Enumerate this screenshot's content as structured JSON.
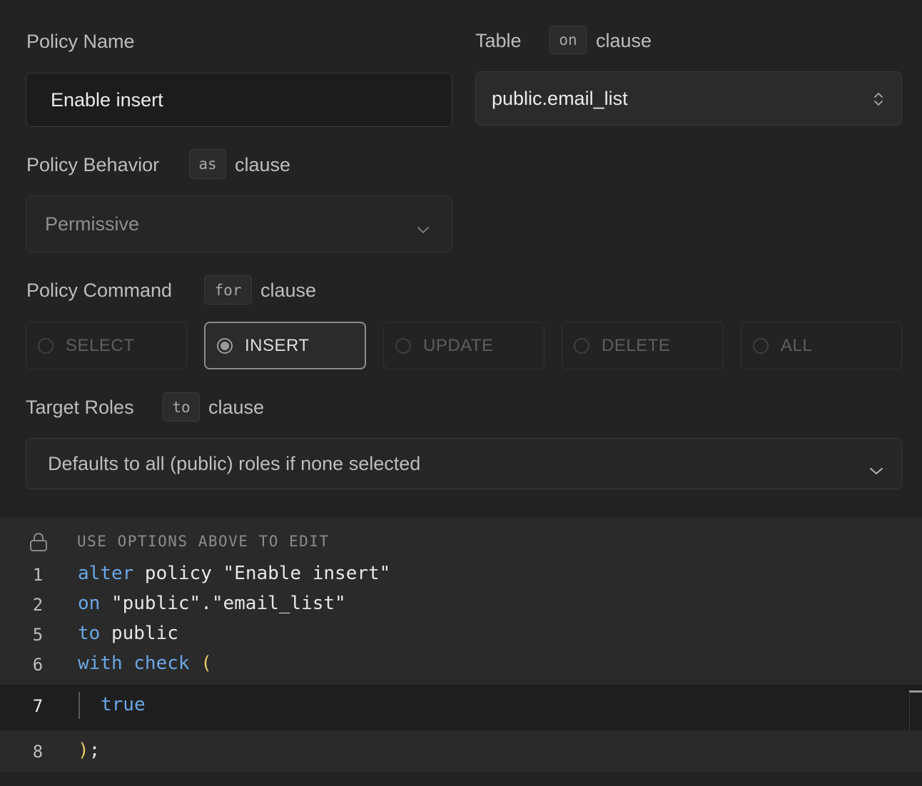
{
  "policy_name": {
    "label": "Policy Name",
    "value": "Enable insert"
  },
  "table": {
    "label": "Table",
    "clause_keyword": "on",
    "clause_label": "clause",
    "value": "public.email_list"
  },
  "behavior": {
    "label": "Policy Behavior",
    "clause_keyword": "as",
    "clause_label": "clause",
    "value": "Permissive"
  },
  "command": {
    "label": "Policy Command",
    "clause_keyword": "for",
    "clause_label": "clause",
    "options": [
      "SELECT",
      "INSERT",
      "UPDATE",
      "DELETE",
      "ALL"
    ],
    "selected": "INSERT"
  },
  "roles": {
    "label": "Target Roles",
    "clause_keyword": "to",
    "clause_label": "clause",
    "placeholder": "Defaults to all (public) roles if none selected"
  },
  "editor": {
    "header": "USE OPTIONS ABOVE TO EDIT",
    "lines": [
      {
        "num": "1",
        "kw": "alter",
        "rest": " policy \"Enable insert\""
      },
      {
        "num": "2",
        "kw": "on",
        "rest": " \"public\".\"email_list\""
      },
      {
        "num": "5",
        "kw": "to",
        "rest": " public"
      },
      {
        "num": "6",
        "kw": "with check",
        "rest": " ("
      },
      {
        "num": "7",
        "kw": "true",
        "rest": ""
      },
      {
        "num": "8",
        "kw": "",
        "rest": ");"
      }
    ]
  },
  "colors": {
    "background": "#232323",
    "keyword": "#6aa7e6",
    "paren": "#e8c766"
  }
}
